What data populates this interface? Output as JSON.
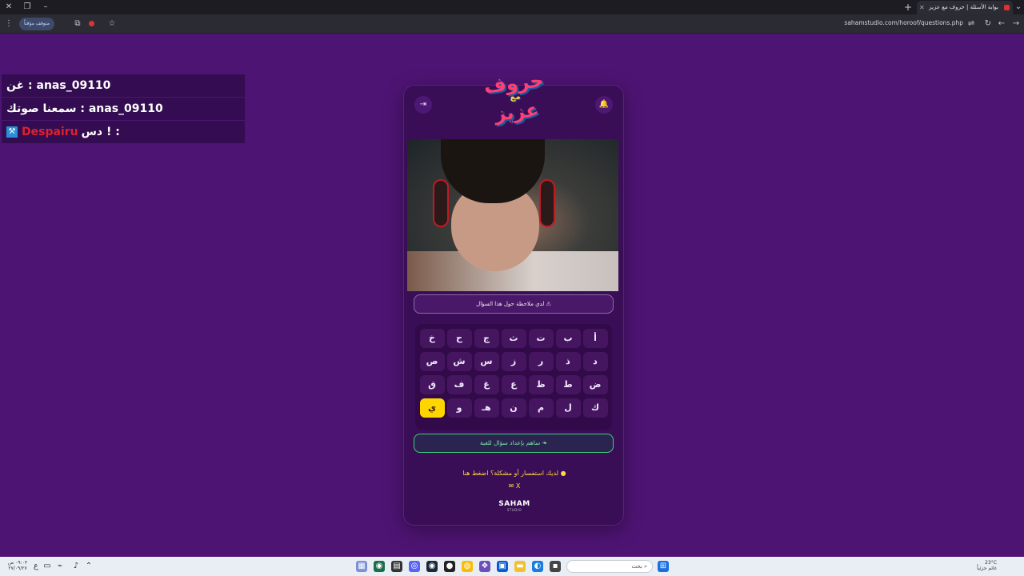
{
  "browser": {
    "tab_title": "بوابة الأسئلة | حروف مع عزيز",
    "url": "sahamstudio.com/horoof/questions.php",
    "paused_label": "متوقف مؤقتاً"
  },
  "chat": [
    {
      "text": "غن : anas_09110",
      "red": false
    },
    {
      "text": "سمعنا صوتك : anas_09110",
      "red": false
    },
    {
      "prefix": "دس ! : ",
      "name": "Despairu",
      "red": true
    }
  ],
  "card": {
    "logo_line1": "حروف",
    "logo_line2": "مع",
    "logo_line3": "عزيز",
    "note_button": "لدي ملاحظة حول هذا السؤال",
    "keyboard": [
      [
        "أ",
        "ب",
        "ت",
        "ث",
        "ج",
        "ح",
        "خ"
      ],
      [
        "د",
        "ذ",
        "ر",
        "ز",
        "س",
        "ش",
        "ص"
      ],
      [
        "ض",
        "ط",
        "ظ",
        "ع",
        "غ",
        "ف",
        "ق"
      ],
      [
        "ك",
        "ل",
        "م",
        "ن",
        "هـ",
        "و",
        "ي"
      ]
    ],
    "active_key": "ي",
    "contribute_button": "ساهم بإعداد سؤال للعبة",
    "help_text": "لديك استفسار أو مشكلة؟ اضغط هنا",
    "social": "✉ X",
    "brand": "SAHAM",
    "brand_sub": "STUDIO"
  },
  "taskbar": {
    "time": "٠٩:٠٣ ص",
    "date": "٢٧/٠٩/٢٧",
    "search_placeholder": "بحث",
    "weather_temp": "23°C",
    "weather_desc": "غائم جزئياً"
  }
}
